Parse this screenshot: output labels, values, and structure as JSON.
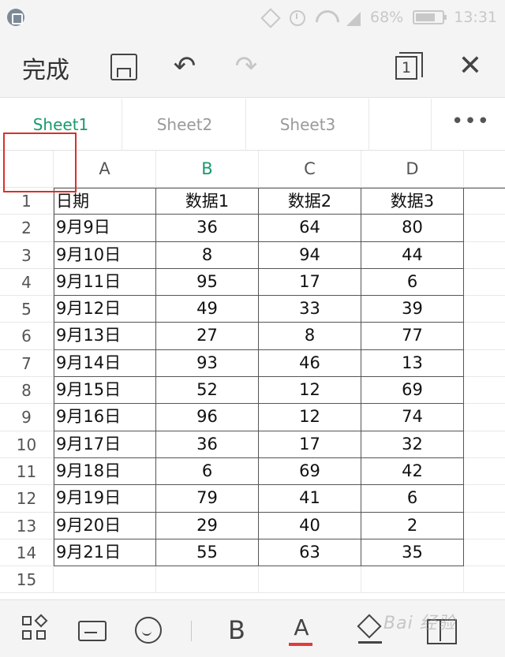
{
  "status_bar": {
    "battery": "68%",
    "time": "13:31",
    "icons": [
      "app-notification-icon",
      "mute-icon",
      "alarm-icon",
      "wifi-icon",
      "signal-icon",
      "battery-icon"
    ]
  },
  "toolbar": {
    "done_label": "完成",
    "icons": [
      "save-icon",
      "undo-icon",
      "redo-icon",
      "sheets-icon",
      "close-icon"
    ],
    "sheet_count": "1"
  },
  "sheet_tabs": [
    {
      "label": "Sheet1",
      "active": true
    },
    {
      "label": "Sheet2",
      "active": false
    },
    {
      "label": "Sheet3",
      "active": false
    }
  ],
  "more_label": "•••",
  "columns": [
    {
      "label": "A",
      "selected": false
    },
    {
      "label": "B",
      "selected": true
    },
    {
      "label": "C",
      "selected": false
    },
    {
      "label": "D",
      "selected": false
    }
  ],
  "row_numbers": [
    "1",
    "2",
    "3",
    "4",
    "5",
    "6",
    "7",
    "8",
    "9",
    "10",
    "11",
    "12",
    "13",
    "14",
    "15"
  ],
  "rows": [
    [
      "日期",
      "数据1",
      "数据2",
      "数据3"
    ],
    [
      "9月9日",
      "36",
      "64",
      "80"
    ],
    [
      "9月10日",
      "8",
      "94",
      "44"
    ],
    [
      "9月11日",
      "95",
      "17",
      "6"
    ],
    [
      "9月12日",
      "49",
      "33",
      "39"
    ],
    [
      "9月13日",
      "27",
      "8",
      "77"
    ],
    [
      "9月14日",
      "93",
      "46",
      "13"
    ],
    [
      "9月15日",
      "52",
      "12",
      "69"
    ],
    [
      "9月16日",
      "96",
      "12",
      "74"
    ],
    [
      "9月17日",
      "36",
      "17",
      "32"
    ],
    [
      "9月18日",
      "6",
      "69",
      "42"
    ],
    [
      "9月19日",
      "79",
      "41",
      "6"
    ],
    [
      "9月20日",
      "29",
      "40",
      "2"
    ],
    [
      "9月21日",
      "55",
      "63",
      "35"
    ]
  ],
  "bottom_bar": {
    "icons": [
      "apps-icon",
      "keyboard-icon",
      "emoji-face-icon",
      "bold-icon",
      "font-color-icon",
      "fill-color-icon",
      "merge-cells-icon"
    ],
    "bold_label": "B",
    "font_color_label": "A",
    "font_color": "#e03b3b"
  },
  "accent_color": "#1a9a6c",
  "watermark": "Bai 经验"
}
